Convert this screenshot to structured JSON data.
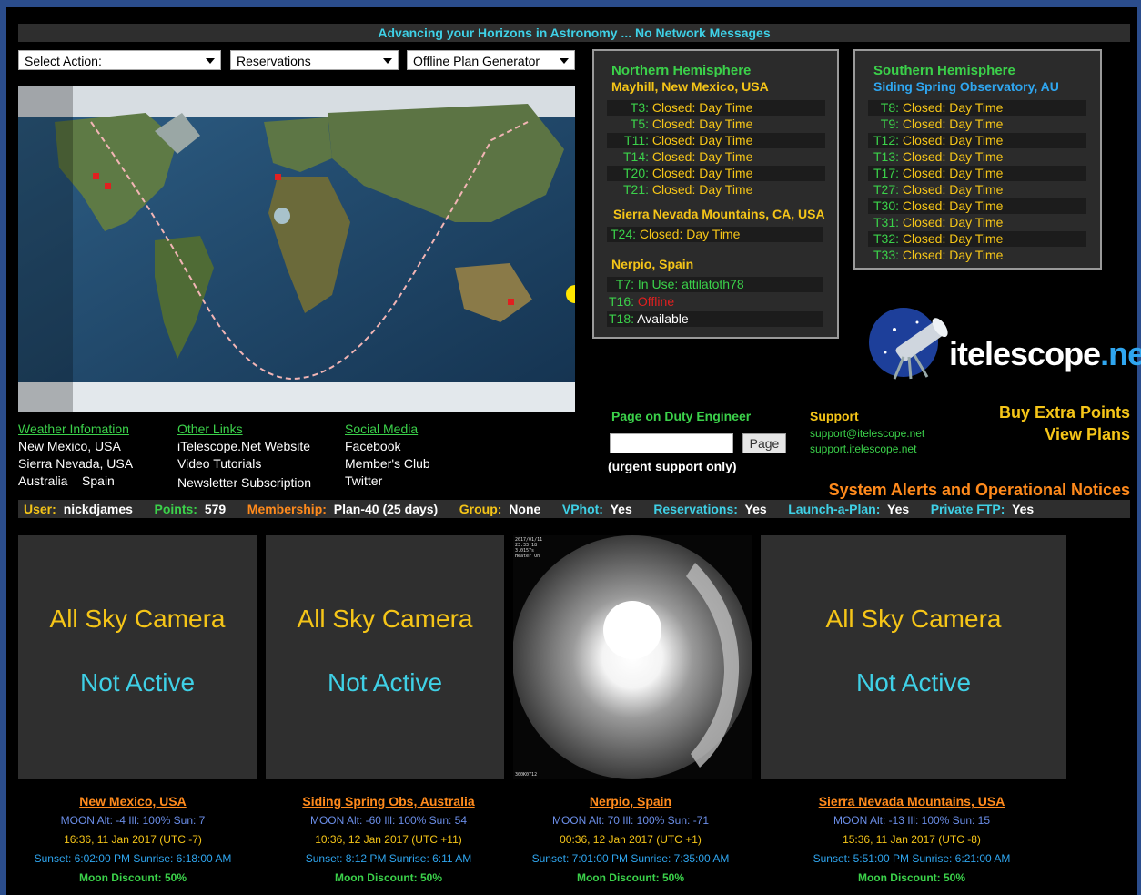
{
  "banner": "Advancing your Horizons in Astronomy ... No Network Messages",
  "selects": [
    {
      "value": "Select Action:"
    },
    {
      "value": "Reservations"
    },
    {
      "value": "Offline Plan Generator"
    }
  ],
  "north": {
    "title": "Northern Hemisphere",
    "sites": [
      {
        "name": "Mayhill, New Mexico, USA",
        "telescopes": [
          {
            "id": "T3:",
            "status": "Closed: Day Time",
            "state": "closed"
          },
          {
            "id": "T5:",
            "status": "Closed: Day Time",
            "state": "closed"
          },
          {
            "id": "T11:",
            "status": "Closed: Day Time",
            "state": "closed"
          },
          {
            "id": "T14:",
            "status": "Closed: Day Time",
            "state": "closed"
          },
          {
            "id": "T20:",
            "status": "Closed: Day Time",
            "state": "closed"
          },
          {
            "id": "T21:",
            "status": "Closed: Day Time",
            "state": "closed"
          }
        ]
      },
      {
        "name": "Sierra Nevada Mountains, CA, USA",
        "telescopes": [
          {
            "id": "T24:",
            "status": "Closed: Day Time",
            "state": "closed"
          }
        ]
      },
      {
        "name": "Nerpio, Spain",
        "telescopes": [
          {
            "id": "T7:",
            "status": "In Use: attilatoth78",
            "state": "inuse"
          },
          {
            "id": "T16:",
            "status": "Offline",
            "state": "offline"
          },
          {
            "id": "T18:",
            "status": "Available",
            "state": "available"
          }
        ]
      }
    ]
  },
  "south": {
    "title": "Southern Hemisphere",
    "site": "Siding Spring Observatory, AU",
    "telescopes": [
      {
        "id": "T8:",
        "status": "Closed: Day Time"
      },
      {
        "id": "T9:",
        "status": "Closed: Day Time"
      },
      {
        "id": "T12:",
        "status": "Closed: Day Time"
      },
      {
        "id": "T13:",
        "status": "Closed: Day Time"
      },
      {
        "id": "T17:",
        "status": "Closed: Day Time"
      },
      {
        "id": "T27:",
        "status": "Closed: Day Time"
      },
      {
        "id": "T30:",
        "status": "Closed: Day Time"
      },
      {
        "id": "T31:",
        "status": "Closed: Day Time"
      },
      {
        "id": "T32:",
        "status": "Closed: Day Time"
      },
      {
        "id": "T33:",
        "status": "Closed: Day Time"
      }
    ]
  },
  "logo": {
    "text_a": "itelescope",
    "text_b": ".net"
  },
  "links": {
    "weather": {
      "title": "Weather Infomation",
      "items": [
        "New Mexico, USA",
        "Sierra Nevada, USA",
        "Australia",
        "Spain"
      ]
    },
    "other": {
      "title": "Other Links",
      "items": [
        "iTelescope.Net Website",
        "Video Tutorials",
        "Newsletter Subscription"
      ]
    },
    "social": {
      "title": "Social Media",
      "items": [
        "Facebook",
        "Member's Club",
        "Twitter"
      ]
    }
  },
  "duty": {
    "title": "Page on Duty Engineer",
    "input_value": "",
    "button": "Page",
    "note": "(urgent support only)"
  },
  "support": {
    "title": "Support",
    "email": "support@itelescope.net",
    "site": "support.itelescope.net"
  },
  "buy_points": "Buy Extra Points",
  "view_plans": "View Plans",
  "alerts": "System Alerts and Operational Notices",
  "userbar": [
    {
      "label": "User:",
      "value": "nickdjames",
      "color": "#f5c518"
    },
    {
      "label": "Points:",
      "value": "579",
      "color": "#3bd14a"
    },
    {
      "label": "Membership:",
      "value": "Plan-40 (25 days)",
      "color": "#ff8a1c"
    },
    {
      "label": "Group:",
      "value": "None",
      "color": "#f5c518"
    },
    {
      "label": "VPhot:",
      "value": "Yes",
      "color": "#3fd0e6"
    },
    {
      "label": "Reservations:",
      "value": "Yes",
      "color": "#3fd0e6"
    },
    {
      "label": "Launch-a-Plan:",
      "value": "Yes",
      "color": "#3fd0e6"
    },
    {
      "label": "Private FTP:",
      "value": "Yes",
      "color": "#3fd0e6"
    }
  ],
  "cameras": [
    {
      "line1": "All Sky Camera",
      "line2": "Not Active"
    },
    {
      "line1": "All Sky Camera",
      "line2": "Not Active"
    },
    {
      "line1": "",
      "line2": "",
      "overlay_top": "2017/01/11\n23:33:18\n3.0157s\nHeater On",
      "overlay_bottom": "300K0712"
    },
    {
      "line1": "All Sky Camera",
      "line2": "Not Active"
    }
  ],
  "sites": [
    {
      "name": "New Mexico, USA",
      "moon": "MOON Alt: -4  Ill: 100%    Sun: 7",
      "time": "16:36, 11 Jan 2017 (UTC -7)",
      "sun": "Sunset: 6:02:00 PM     Sunrise: 6:18:00 AM",
      "discount": "Moon Discount: 50%"
    },
    {
      "name": "Siding Spring Obs, Australia",
      "moon": "MOON Alt: -60  Ill: 100%    Sun: 54",
      "time": "10:36, 12 Jan 2017 (UTC +11)",
      "sun": "Sunset: 8:12 PM     Sunrise: 6:11 AM",
      "discount": "Moon Discount: 50%"
    },
    {
      "name": "Nerpio, Spain",
      "moon": "MOON Alt: 70  Ill: 100%    Sun: -71",
      "time": "00:36, 12 Jan 2017 (UTC +1)",
      "sun": "Sunset: 7:01:00 PM     Sunrise: 7:35:00 AM",
      "discount": "Moon Discount: 50%"
    },
    {
      "name": "Sierra Nevada Mountains, USA",
      "moon": "MOON Alt: -13  Ill: 100%    Sun: 15",
      "time": "15:36, 11 Jan 2017 (UTC -8)",
      "sun": "Sunset: 5:51:00 PM     Sunrise: 6:21:00 AM",
      "discount": "Moon Discount: 50%"
    }
  ]
}
